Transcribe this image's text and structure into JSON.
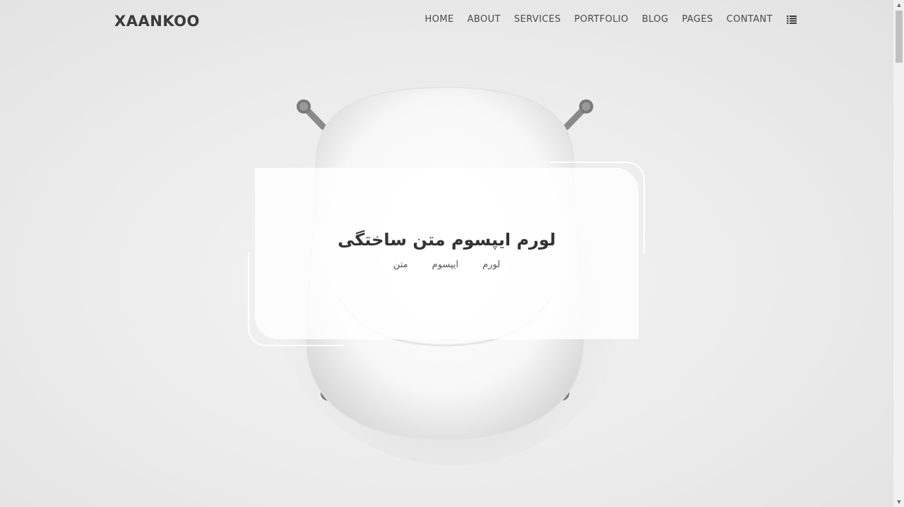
{
  "header": {
    "logo": "XAANKOO",
    "nav": [
      "HOME",
      "ABOUT",
      "SERVICES",
      "PORTFOLIO",
      "BLOG",
      "PAGES",
      "CONTANT"
    ],
    "menu_icon": "list-menu-icon"
  },
  "hero": {
    "title": "لورم ایپسوم متن ساختگی",
    "meta": [
      "لورم",
      "ایپسوم",
      "متن"
    ]
  },
  "scrollbar": {
    "up_arrow": "▲",
    "down_arrow": "▼"
  },
  "colors": {
    "text": "#3a3a3a",
    "background": "#e9e9e9",
    "card": "#ffffff"
  }
}
